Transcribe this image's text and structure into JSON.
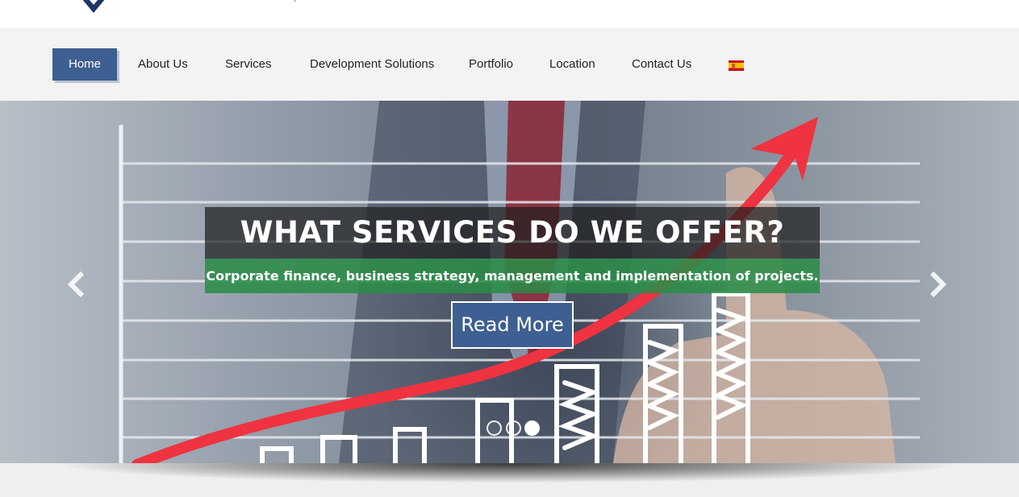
{
  "nav": {
    "items": [
      {
        "label": "Home",
        "active": true
      },
      {
        "label": "About Us"
      },
      {
        "label": "Services"
      },
      {
        "label": "Development Solutions"
      },
      {
        "label": "Portfolio"
      },
      {
        "label": "Location"
      },
      {
        "label": "Contact Us"
      }
    ],
    "language_flag": "spain-flag-icon"
  },
  "slider": {
    "title": "WHAT SERVICES DO WE OFFER?",
    "subtitle": "Corporate finance, business strategy, management and implementation of projects.",
    "button_label": "Read More",
    "prev_icon": "chevron-left-icon",
    "next_icon": "chevron-right-icon",
    "slide_count": 3,
    "active_slide": 3
  },
  "colors": {
    "accent": "#3e5f91",
    "caption_green": "#2b8c48",
    "nav_background": "#f3f3f3"
  }
}
